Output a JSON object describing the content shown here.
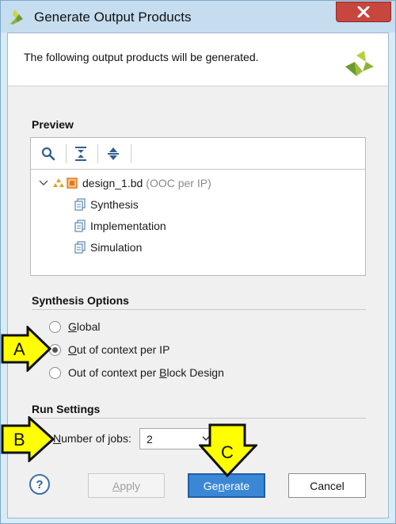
{
  "window": {
    "title": "Generate Output Products"
  },
  "header": {
    "description": "The following output products will be generated."
  },
  "preview": {
    "section_title": "Preview",
    "tree": {
      "root_name": "design_1.bd",
      "root_note": "(OOC per IP)",
      "children": [
        {
          "label": "Synthesis"
        },
        {
          "label": "Implementation"
        },
        {
          "label": "Simulation"
        }
      ]
    }
  },
  "synthesis_options": {
    "section_title": "Synthesis Options",
    "options": [
      {
        "prefix": "",
        "mnemonic": "G",
        "suffix": "lobal",
        "selected": false
      },
      {
        "prefix": "",
        "mnemonic": "O",
        "suffix": "ut of context per IP",
        "selected": true
      },
      {
        "prefix": "Out of context per ",
        "mnemonic": "B",
        "suffix": "lock Design",
        "selected": false
      }
    ]
  },
  "run_settings": {
    "section_title": "Run Settings",
    "jobs_label_prefix": "",
    "jobs_label_mnemonic": "N",
    "jobs_label_suffix": "umber of jobs:",
    "jobs_value": "2"
  },
  "buttons": {
    "help_label": "?",
    "apply_mnemonic": "A",
    "apply_suffix": "pply",
    "generate_prefix": "Ge",
    "generate_mnemonic": "n",
    "generate_suffix": "erate",
    "cancel_label": "Cancel"
  },
  "annotations": {
    "a": "A",
    "b": "B",
    "c": "C"
  },
  "colors": {
    "accent": "#3a87d6",
    "callout_fill": "#ffff00",
    "close_button": "#c7463e"
  }
}
